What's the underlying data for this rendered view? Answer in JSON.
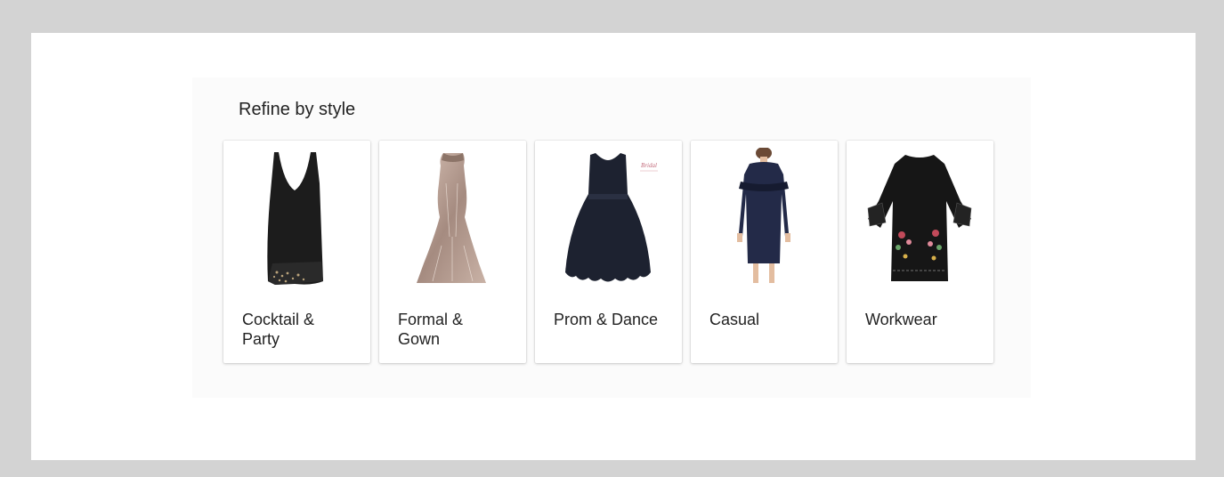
{
  "refine": {
    "title": "Refine by style",
    "cards": [
      {
        "label": "Cocktail & Party",
        "image": "black-sleeveless-dress"
      },
      {
        "label": "Formal & Gown",
        "image": "sequin-mermaid-gown"
      },
      {
        "label": "Prom & Dance",
        "image": "navy-scalloped-dress"
      },
      {
        "label": "Casual",
        "image": "navy-ruffle-dress-model"
      },
      {
        "label": "Workwear",
        "image": "black-embroidered-bell-sleeve-dress"
      }
    ]
  }
}
